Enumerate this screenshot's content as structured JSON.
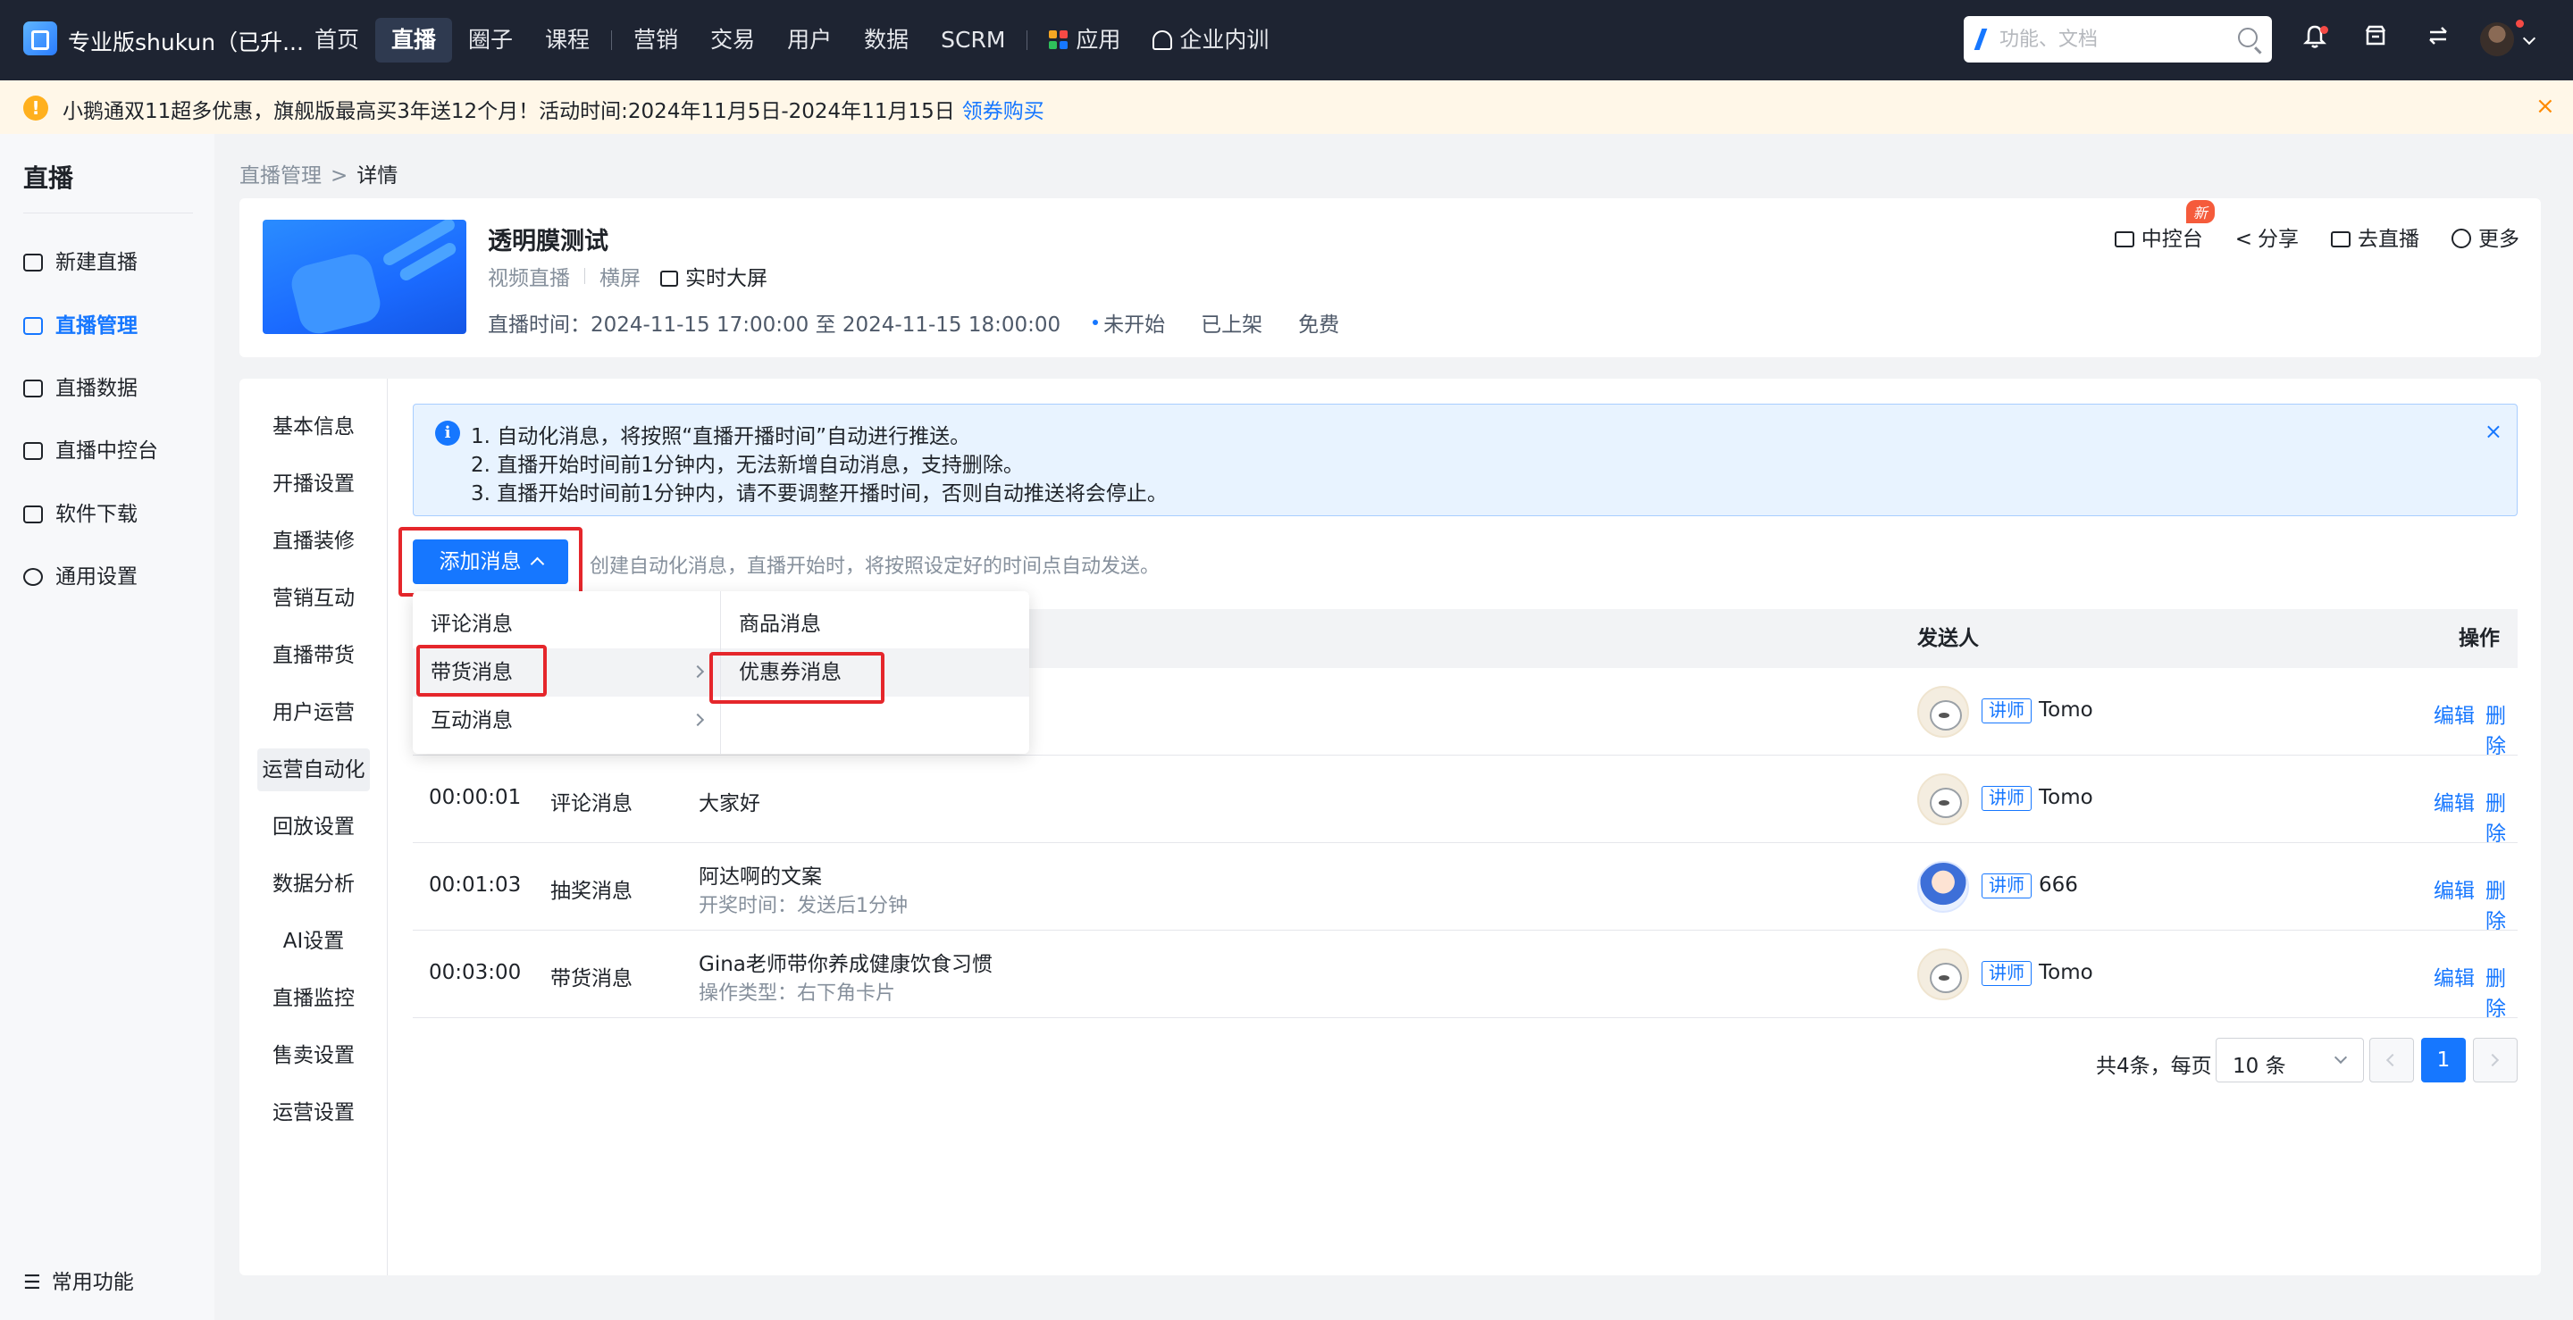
{
  "topnav": {
    "app_name": "专业版shukun（已升...",
    "items": [
      "首页",
      "直播",
      "圈子",
      "课程",
      "营销",
      "交易",
      "用户",
      "数据",
      "SCRM",
      "应用",
      "企业内训"
    ],
    "search_placeholder": "功能、文档",
    "icons": [
      "bell-icon",
      "shop-icon",
      "swap-icon",
      "avatar"
    ]
  },
  "notice": {
    "text": "小鹅通双11超多优惠，旗舰版最高买3年送12个月！活动时间:2024年11月5日-2024年11月15日",
    "link": "领券购买",
    "close": "×"
  },
  "sidebar": {
    "title": "直播",
    "items": [
      "新建直播",
      "直播管理",
      "直播数据",
      "直播中控台",
      "软件下载",
      "通用设置"
    ],
    "bottom": "常用功能"
  },
  "breadcrumb": {
    "parent": "直播管理",
    "sep": ">",
    "current": "详情"
  },
  "header": {
    "title": "透明膜测试",
    "meta": [
      "视频直播",
      "横屏"
    ],
    "screen": "实时大屏",
    "time_label": "直播时间：",
    "time": "2024-11-15 17:00:00 至 2024-11-15 18:00:00",
    "status": "未开始",
    "shelf": "已上架",
    "price": "免费",
    "actions": [
      "中控台",
      "分享",
      "去直播",
      "更多"
    ],
    "new_badge": "新"
  },
  "inner_nav": [
    "基本信息",
    "开播设置",
    "直播装修",
    "营销互动",
    "直播带货",
    "用户运营",
    "运营自动化",
    "回放设置",
    "数据分析",
    "AI设置",
    "直播监控",
    "售卖设置",
    "运营设置"
  ],
  "alert": {
    "icon": "i",
    "lines": [
      "1. 自动化消息，将按照“直播开播时间”自动进行推送。",
      "2. 直播开始时间前1分钟内，无法新增自动消息，支持删除。",
      "3. 直播开始时间前1分钟内，请不要调整开播时间，否则自动推送将会停止。"
    ],
    "close": "×"
  },
  "toolbar": {
    "add_label": "添加消息",
    "hint": "创建自动化消息，直播开始时，将按照设定好的时间点自动发送。"
  },
  "dropdown": {
    "left": [
      "评论消息",
      "带货消息",
      "互动消息"
    ],
    "right": [
      "商品消息",
      "优惠券消息"
    ]
  },
  "table": {
    "headers": {
      "sender": "发送人",
      "ops": "操作"
    },
    "rows": [
      {
        "time": "",
        "type": "",
        "content": "",
        "sub": "",
        "tag": "讲师",
        "sender": "Tomo",
        "edit": "编辑",
        "del": "删除"
      },
      {
        "time": "00:00:01",
        "type": "评论消息",
        "content": "大家好",
        "sub": "",
        "tag": "讲师",
        "sender": "Tomo",
        "edit": "编辑",
        "del": "删除"
      },
      {
        "time": "00:01:03",
        "type": "抽奖消息",
        "content": "阿达啊的文案",
        "sub": "开奖时间：发送后1分钟",
        "tag": "讲师",
        "sender": "666",
        "edit": "编辑",
        "del": "删除"
      },
      {
        "time": "00:03:00",
        "type": "带货消息",
        "content": "Gina老师带你养成健康饮食习惯",
        "sub": "操作类型：右下角卡片",
        "tag": "讲师",
        "sender": "Tomo",
        "edit": "编辑",
        "del": "删除"
      }
    ]
  },
  "pagination": {
    "total": "共4条，每页",
    "page_size": "10 条",
    "current": "1"
  },
  "colors": {
    "accent": "#1677ff",
    "highlight": "#e5262b",
    "nav_bg": "#1e2432"
  }
}
